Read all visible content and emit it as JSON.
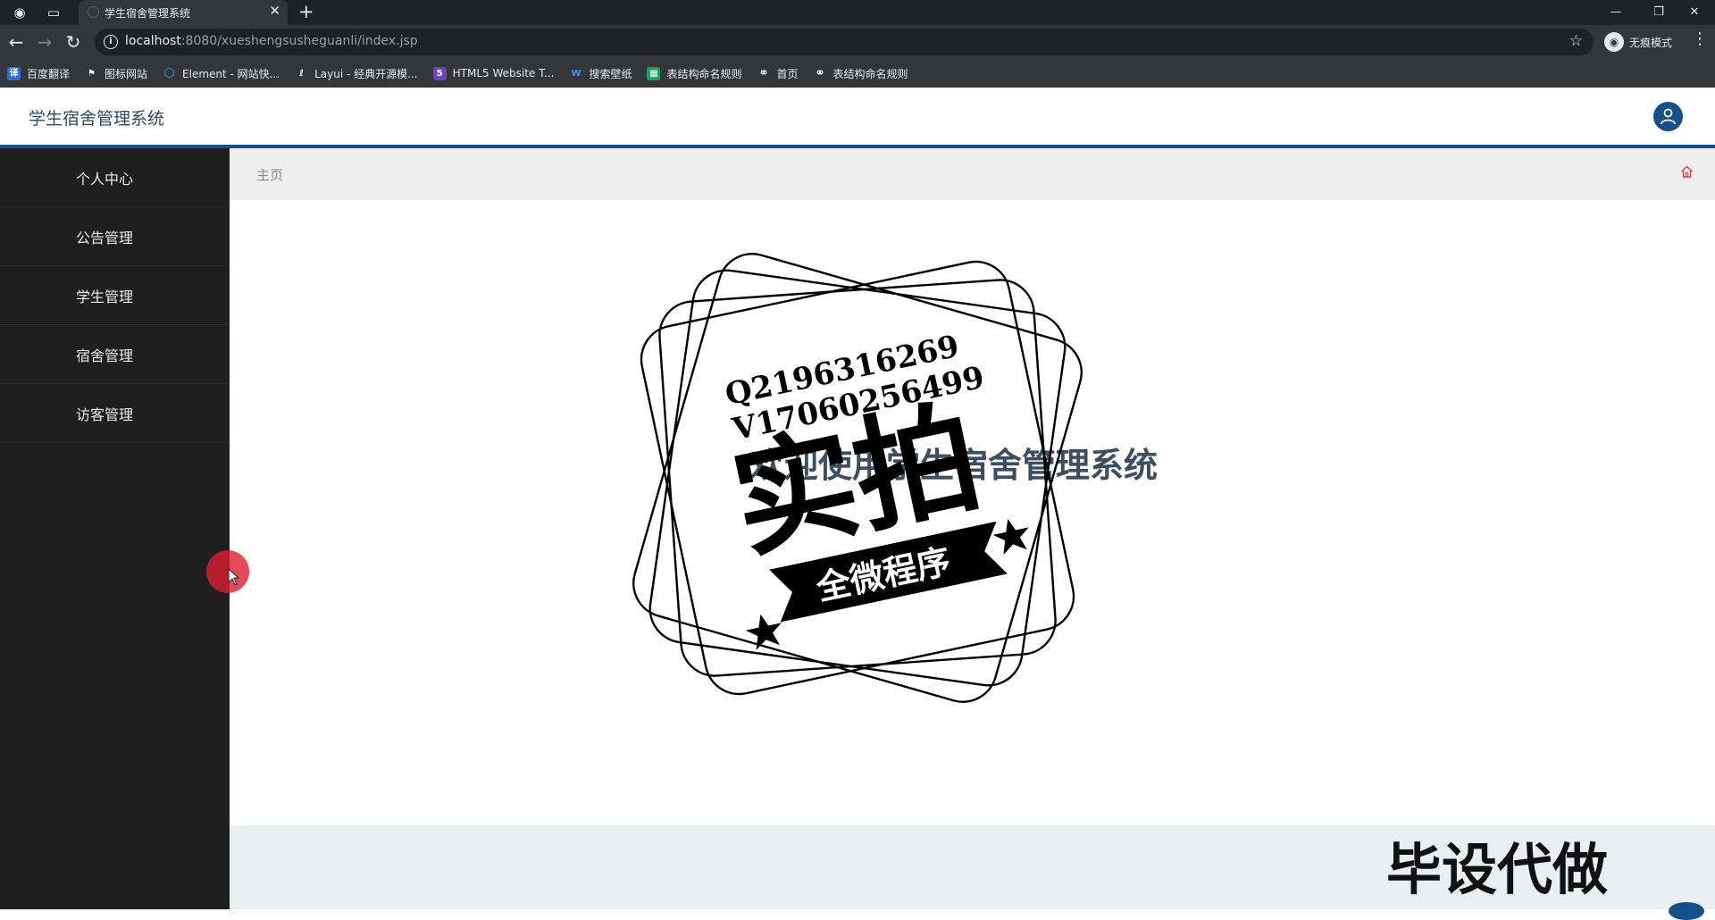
{
  "browser": {
    "tab_title": "学生宿舍管理系统",
    "url_host": "localhost",
    "url_path": ":8080/xueshengsusheguanli/index.jsp",
    "incognito_label": "无痕模式",
    "bookmarks": [
      {
        "label": "百度翻译",
        "icon": "baidu-translate-icon",
        "color": "#2b6de5"
      },
      {
        "label": "图标网站",
        "icon": "flag-icon",
        "color": "#35363a"
      },
      {
        "label": "Element - 网站快...",
        "icon": "element-icon",
        "color": "#409eff"
      },
      {
        "label": "Layui - 经典开源模...",
        "icon": "layui-icon",
        "color": "#35363a"
      },
      {
        "label": "HTML5 Website T...",
        "icon": "html5-icon",
        "color": "#6f42c1"
      },
      {
        "label": "搜索壁纸",
        "icon": "wallpaper-icon",
        "color": "#1e6fd9"
      },
      {
        "label": "表结构命名规则",
        "icon": "table-icon",
        "color": "#1aa260"
      },
      {
        "label": "首页",
        "icon": "globe-icon",
        "color": "#35363a"
      },
      {
        "label": "表结构命名规则",
        "icon": "globe-icon",
        "color": "#35363a"
      }
    ]
  },
  "app": {
    "title": "学生宿舍管理系统",
    "menu": [
      {
        "label": "个人中心"
      },
      {
        "label": "公告管理"
      },
      {
        "label": "学生管理"
      },
      {
        "label": "宿舍管理"
      },
      {
        "label": "访客管理"
      }
    ],
    "breadcrumb": "主页",
    "welcome": "欢迎使用学生宿舍管理系统"
  },
  "watermark": {
    "line1": "Q2196316269",
    "line2": "V1706025649​9",
    "big": "实拍",
    "ribbon": "全微程序",
    "corner_text": "毕设代做"
  },
  "colors": {
    "accent": "#14508a",
    "sidebar": "#1f1f1f",
    "title": "#2c4a6b"
  }
}
